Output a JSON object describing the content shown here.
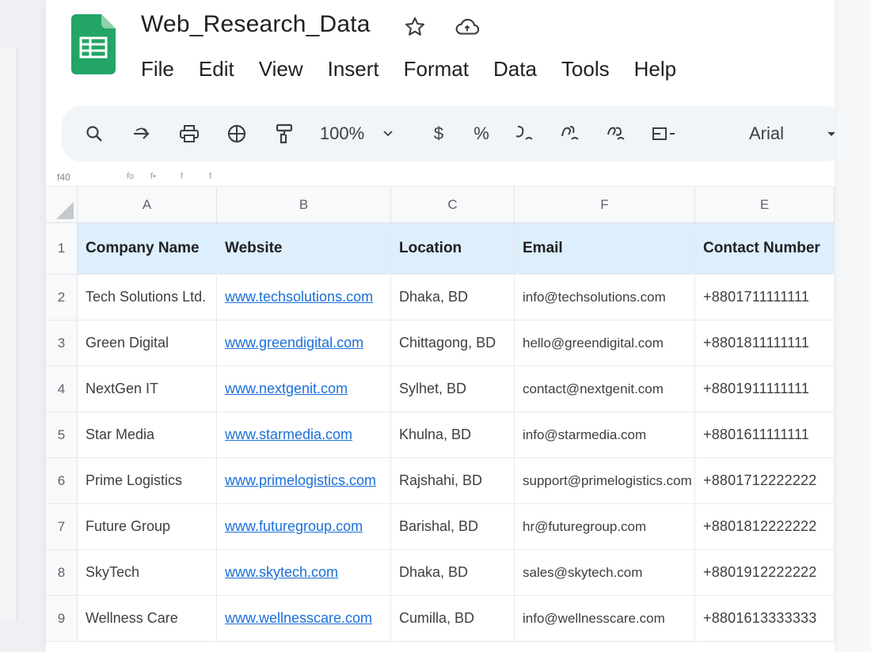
{
  "document": {
    "title": "Web_Research_Data"
  },
  "menu": [
    "File",
    "Edit",
    "View",
    "Insert",
    "Format",
    "Data",
    "Tools",
    "Help"
  ],
  "toolbar": {
    "zoom": "100%",
    "currency": "$",
    "percent": "%",
    "font": "Arial"
  },
  "formula_bar": {
    "cell_ref": "f40",
    "fx_a": "fo",
    "fx_b": "f•",
    "fx_c": "f",
    "fx_d": "f"
  },
  "columns": [
    "A",
    "B",
    "C",
    "F",
    "E"
  ],
  "rows": [
    {
      "num": "1",
      "company": "Company Name",
      "website": "Website",
      "location": "Location",
      "email": "Email",
      "phone": "Contact Number"
    },
    {
      "num": "2",
      "company": "Tech Solutions Ltd.",
      "website": "www.techsolutions.com",
      "location": "Dhaka, BD",
      "email": "info@techsolutions.com",
      "phone": "+8801711111111"
    },
    {
      "num": "3",
      "company": "Green Digital",
      "website": "www.greendigital.com",
      "location": "Chittagong, BD",
      "email": "hello@greendigital.com",
      "phone": "+8801811111111"
    },
    {
      "num": "4",
      "company": "NextGen IT",
      "website": "www.nextgenit.com",
      "location": "Sylhet, BD",
      "email": "contact@nextgenit.com",
      "phone": "+8801911111111"
    },
    {
      "num": "5",
      "company": "Star Media",
      "website": "www.starmedia.com",
      "location": "Khulna, BD",
      "email": "info@starmedia.com",
      "phone": "+8801611111111"
    },
    {
      "num": "6",
      "company": "Prime Logistics",
      "website": "www.primelogistics.com",
      "location": "Rajshahi, BD",
      "email": "support@primelogistics.com",
      "phone": "+8801712222222"
    },
    {
      "num": "7",
      "company": "Future Group",
      "website": "www.futuregroup.com",
      "location": "Barishal, BD",
      "email": "hr@futuregroup.com",
      "phone": "+8801812222222"
    },
    {
      "num": "8",
      "company": "SkyTech",
      "website": "www.skytech.com",
      "location": "Dhaka, BD",
      "email": "sales@skytech.com",
      "phone": "+8801912222222"
    },
    {
      "num": "9",
      "company": "Wellness Care",
      "website": "www.wellnesscare.com",
      "location": "Cumilla, BD",
      "email": "info@wellnesscare.com",
      "phone": "+8801613333333"
    }
  ],
  "colors": {
    "header_fill": "#ddeefc",
    "link": "#1a6fd8",
    "sheets_green": "#0f9d58"
  }
}
